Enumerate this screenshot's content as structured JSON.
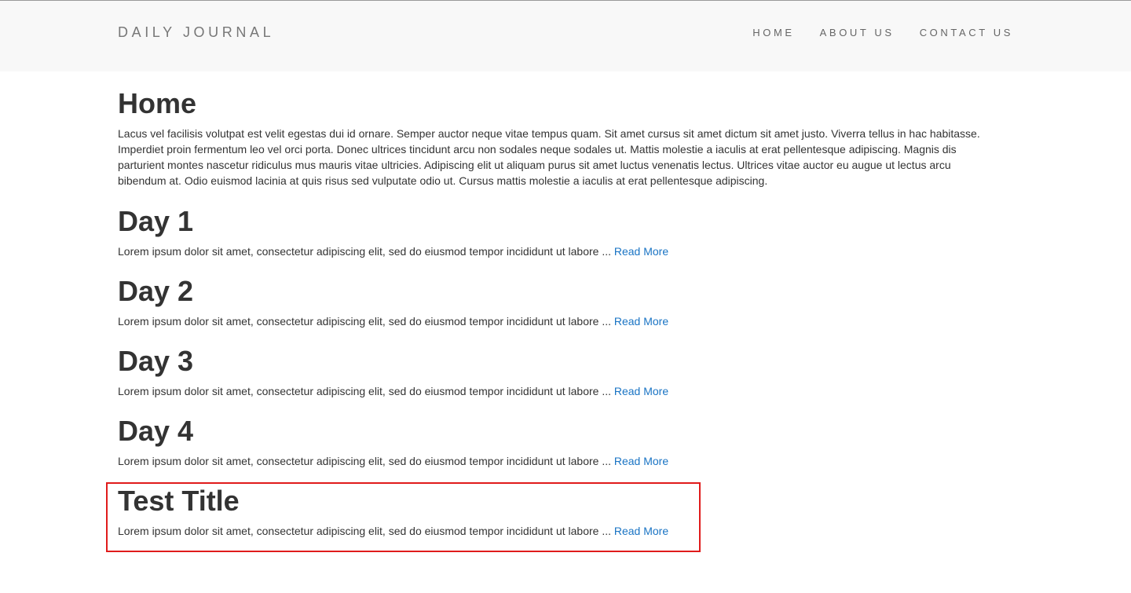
{
  "header": {
    "brand": "DAILY JOURNAL",
    "nav": [
      {
        "label": "HOME"
      },
      {
        "label": "ABOUT US"
      },
      {
        "label": "CONTACT US"
      }
    ]
  },
  "main": {
    "title": "Home",
    "intro": "Lacus vel facilisis volutpat est velit egestas dui id ornare. Semper auctor neque vitae tempus quam. Sit amet cursus sit amet dictum sit amet justo. Viverra tellus in hac habitasse. Imperdiet proin fermentum leo vel orci porta. Donec ultrices tincidunt arcu non sodales neque sodales ut. Mattis molestie a iaculis at erat pellentesque adipiscing. Magnis dis parturient montes nascetur ridiculus mus mauris vitae ultricies. Adipiscing elit ut aliquam purus sit amet luctus venenatis lectus. Ultrices vitae auctor eu augue ut lectus arcu bibendum at. Odio euismod lacinia at quis risus sed vulputate odio ut. Cursus mattis molestie a iaculis at erat pellentesque adipiscing.",
    "posts": [
      {
        "title": "Day 1",
        "excerpt": "Lorem ipsum dolor sit amet, consectetur adipiscing elit, sed do eiusmod tempor incididunt ut labore ... ",
        "link": "Read More"
      },
      {
        "title": "Day 2",
        "excerpt": "Lorem ipsum dolor sit amet, consectetur adipiscing elit, sed do eiusmod tempor incididunt ut labore ... ",
        "link": "Read More"
      },
      {
        "title": "Day 3",
        "excerpt": "Lorem ipsum dolor sit amet, consectetur adipiscing elit, sed do eiusmod tempor incididunt ut labore ... ",
        "link": "Read More"
      },
      {
        "title": "Day 4",
        "excerpt": "Lorem ipsum dolor sit amet, consectetur adipiscing elit, sed do eiusmod tempor incididunt ut labore ... ",
        "link": "Read More"
      },
      {
        "title": "Test Title",
        "excerpt": "Lorem ipsum dolor sit amet, consectetur adipiscing elit, sed do eiusmod tempor incididunt ut labore ... ",
        "link": "Read More"
      }
    ]
  },
  "colors": {
    "navbar_bg": "#f8f8f8",
    "text": "#333333",
    "link": "#1a74c4",
    "highlight": "#e01b1b"
  }
}
